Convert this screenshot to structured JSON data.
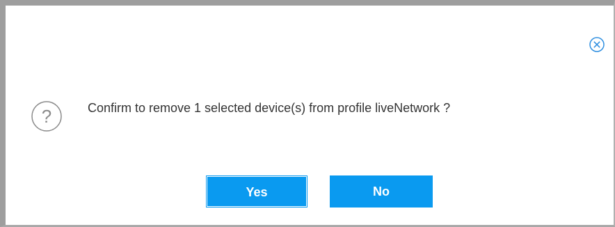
{
  "dialog": {
    "message": "Confirm to remove 1 selected device(s) from profile liveNetwork ?",
    "icons": {
      "close": "close-circle-icon",
      "status": "question-circle-icon"
    },
    "buttons": {
      "yes_label": "Yes",
      "no_label": "No"
    },
    "colors": {
      "accent": "#0a9af0",
      "close_icon": "#2f8fe0",
      "question_icon": "#8a8a8a",
      "text": "#333333"
    }
  }
}
